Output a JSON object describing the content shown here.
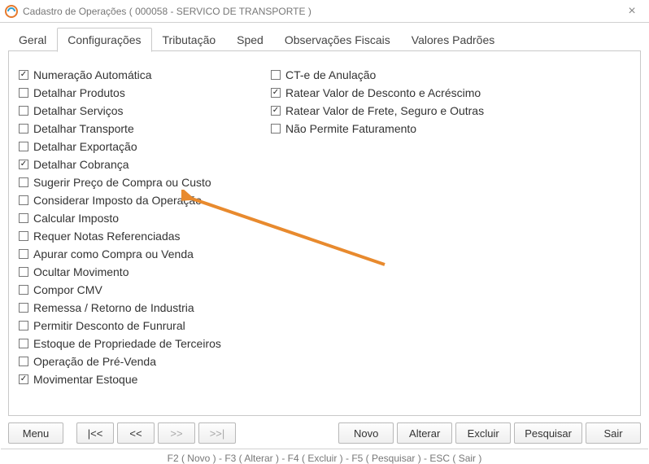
{
  "window": {
    "title": "Cadastro de Operações ( 000058 - SERVICO DE TRANSPORTE )"
  },
  "tabs": {
    "geral": "Geral",
    "configuracoes": "Configurações",
    "tributacao": "Tributação",
    "sped": "Sped",
    "observacoes": "Observações Fiscais",
    "valores": "Valores Padrões"
  },
  "options_left": [
    {
      "id": "numeracao-automatica",
      "label": "Numeração Automática",
      "checked": true
    },
    {
      "id": "detalhar-produtos",
      "label": "Detalhar Produtos",
      "checked": false
    },
    {
      "id": "detalhar-servicos",
      "label": "Detalhar Serviços",
      "checked": false
    },
    {
      "id": "detalhar-transporte",
      "label": "Detalhar Transporte",
      "checked": false
    },
    {
      "id": "detalhar-exportacao",
      "label": "Detalhar Exportação",
      "checked": false
    },
    {
      "id": "detalhar-cobranca",
      "label": "Detalhar Cobrança",
      "checked": true
    },
    {
      "id": "sugerir-preco",
      "label": "Sugerir Preço de Compra ou Custo",
      "checked": false
    },
    {
      "id": "considerar-imposto",
      "label": "Considerar Imposto da Operação",
      "checked": false
    },
    {
      "id": "calcular-imposto",
      "label": "Calcular Imposto",
      "checked": false
    },
    {
      "id": "requer-notas",
      "label": "Requer Notas Referenciadas",
      "checked": false
    },
    {
      "id": "apurar-compra-venda",
      "label": "Apurar como Compra ou Venda",
      "checked": false
    },
    {
      "id": "ocultar-movimento",
      "label": "Ocultar Movimento",
      "checked": false
    },
    {
      "id": "compor-cmv",
      "label": "Compor CMV",
      "checked": false
    },
    {
      "id": "remessa-retorno",
      "label": "Remessa / Retorno de Industria",
      "checked": false
    },
    {
      "id": "permitir-funrural",
      "label": "Permitir Desconto de Funrural",
      "checked": false
    },
    {
      "id": "estoque-terceiros",
      "label": "Estoque de Propriedade de Terceiros",
      "checked": false
    },
    {
      "id": "operacao-prevenda",
      "label": "Operação de Pré-Venda",
      "checked": false
    },
    {
      "id": "movimentar-estoque",
      "label": "Movimentar Estoque",
      "checked": true
    }
  ],
  "options_right": [
    {
      "id": "cte-anulacao",
      "label": "CT-e de Anulação",
      "checked": false
    },
    {
      "id": "ratear-desconto",
      "label": "Ratear Valor de Desconto e Acréscimo",
      "checked": true
    },
    {
      "id": "ratear-frete",
      "label": "Ratear Valor de Frete, Seguro e Outras",
      "checked": true
    },
    {
      "id": "nao-permite-faturamento",
      "label": "Não Permite Faturamento",
      "checked": false
    }
  ],
  "buttons": {
    "menu": "Menu",
    "first": "|<<",
    "prev": "<<",
    "next": ">>",
    "last": ">>|",
    "novo": "Novo",
    "alterar": "Alterar",
    "excluir": "Excluir",
    "pesquisar": "Pesquisar",
    "sair": "Sair"
  },
  "statusbar": "F2 ( Novo )  -  F3 ( Alterar )  -  F4 ( Excluir )  -  F5 ( Pesquisar )  -  ESC ( Sair )"
}
